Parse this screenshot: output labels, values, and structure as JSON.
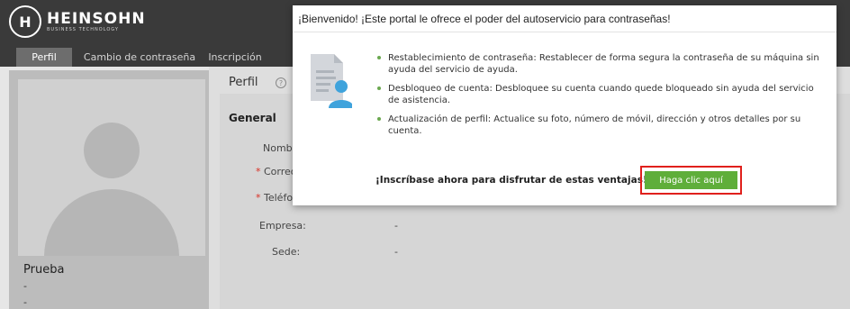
{
  "header": {
    "logo_mark": "H",
    "brand_name": "HEINSOHN",
    "brand_tagline": "BUSINESS TECHNOLOGY"
  },
  "tabs": [
    {
      "label": "Perfil",
      "active": true
    },
    {
      "label": "Cambio de contraseña",
      "active": false
    },
    {
      "label": "Inscripción",
      "active": false
    }
  ],
  "profile": {
    "name": "Prueba",
    "line1": "-",
    "line2": "-"
  },
  "main": {
    "title": "Perfil",
    "help_symbol": "?",
    "section_title": "General",
    "fields": [
      {
        "label": "Nombr",
        "required": false,
        "value": ""
      },
      {
        "label": "Correo",
        "required": true,
        "value": ""
      },
      {
        "label": "Teléfo",
        "required": true,
        "value": ""
      },
      {
        "label": "Empresa:",
        "required": false,
        "value": "-"
      },
      {
        "label": "Sede:",
        "required": false,
        "value": "-"
      }
    ],
    "required_mark": "*"
  },
  "modal": {
    "title": "¡Bienvenido! ¡Este portal le ofrece el poder del autoservicio para contraseñas!",
    "benefits": [
      "Restablecimiento de contraseña: Restablecer de forma segura la contraseña de su máquina sin ayuda del servicio de ayuda.",
      "Desbloqueo de cuenta: Desbloquee su cuenta cuando quede bloqueado sin ayuda del servicio de asistencia.",
      "Actualización de perfil: Actualice su foto, número de móvil, dirección y otros detalles por su cuenta."
    ],
    "cta_text": "¡Inscríbase ahora para disfrutar de estas ventajas!",
    "cta_button": "Haga clic aquí"
  },
  "colors": {
    "header_bg": "#3a3a3a",
    "active_tab": "#6d6d6d",
    "cta_green": "#5fae3a",
    "highlight_red": "#e0201c",
    "bullet_green": "#6aa84f",
    "required_red": "#d93025"
  },
  "icons": {
    "logo": "heinsohn-logo-icon",
    "help": "help-circle-icon",
    "document_user": "document-user-icon"
  }
}
